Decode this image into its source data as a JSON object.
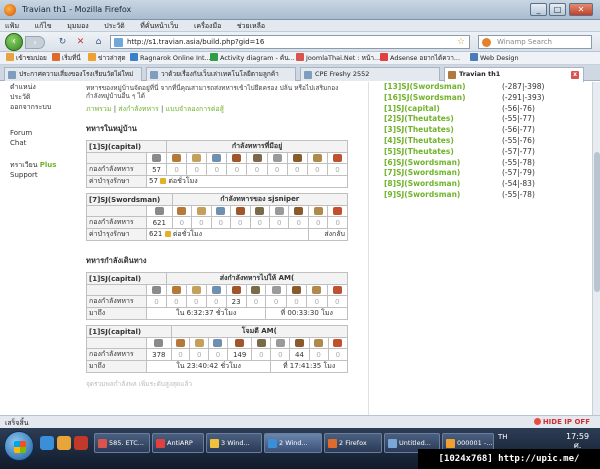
{
  "window": {
    "title": "Travian th1 - Mozilla Firefox",
    "min": "_",
    "max": "□",
    "close": "✕"
  },
  "menu": [
    "แฟ้ม",
    "แก้ไข",
    "มุมมอง",
    "ประวัติ",
    "ที่คั่นหน้าเว็บ",
    "เครื่องมือ",
    "ช่วยเหลือ"
  ],
  "nav": {
    "url": "http://s1.travian.asia/build.php?gid=16",
    "search_placeholder": "Winamp Search"
  },
  "bookmarks": [
    "เข้าชมบ่อย",
    "เริ่มที่นี่",
    "ข่าวล่าสุด",
    "Ragnarok Online Int...",
    "Activity diagram - ค้น...",
    "JoomlaThai.Net : หน้า...",
    "Adsense อยากได้ควา...",
    "Web Design"
  ],
  "tabs": [
    "ประกาศความเสี่ยงของโรงเรียนวัดไผ่ใหม่",
    "วาด้วยเรื่องกับเว็บเล่าเทคโนโลยีตามลูกค้า",
    "CPE Freshy 2552",
    "Travian th1"
  ],
  "leftmenu": {
    "items": [
      "ตำแหน่ง",
      "ประวัติ",
      "ออกจากระบบ"
    ],
    "forum": "Forum",
    "chat": "Chat",
    "plus_prefix": "ทราเวียน",
    "plus": "Plus",
    "support": "Support"
  },
  "main": {
    "intro": "ทหารของหมู่บ้านจัดอยู่ที่นี่ จากที่นี่คุณสามารถส่งทหารเข้าไปยึดครอง ปล้น หรือไปเสริมกองกำลังหมู่บ้านอื่น ๆ ได้",
    "links": [
      "ภาพรวม",
      "ส่งกำลังทหาร",
      "แบบจำลองการต่อสู้"
    ],
    "in_village": "ทหารในหมู่บ้าน",
    "on_move": "ทหารกำลังเดินทาง",
    "row_troops": "กองกำลังทหาร",
    "row_upkeep": "ค่าบำรุงรักษา",
    "row_arrival": "มาถึง",
    "per_hour": "ต่อชั่วโมง",
    "footnote": "จุดรวมพลกำลังพล เพิ่มระดับสูงสุดแล้ว",
    "tables": [
      {
        "village": "[1]SJ(capital)",
        "head": "กำลังทหารที่มีอยู่",
        "values": [
          "57",
          "0",
          "0",
          "0",
          "0",
          "0",
          "0",
          "0",
          "0",
          "0"
        ],
        "upkeep": "57",
        "extra": ""
      },
      {
        "village": "[7]SJ(Swordsman)",
        "head": "กำลังทหารของ sjsniper",
        "values": [
          "621",
          "0",
          "0",
          "0",
          "0",
          "0",
          "0",
          "0",
          "0",
          "0"
        ],
        "upkeep": "621",
        "extra": "ส่งกลับ"
      },
      {
        "village": "[1]SJ(capital)",
        "head": "ส่งกำลังทหารไปให้ AM(",
        "values": [
          "0",
          "0",
          "0",
          "0",
          "23",
          "0",
          "0",
          "0",
          "0",
          "0"
        ],
        "eta": "ใน 6:32:37 ชั่วโมง",
        "time": "ที่ 00:33:30 โมง"
      },
      {
        "village": "[1]SJ(capital)",
        "head": "โจมตี AM(",
        "values": [
          "378",
          "0",
          "0",
          "0",
          "149",
          "0",
          "0",
          "44",
          "0",
          "0"
        ],
        "eta": "ใน 23:40:42 ชั่วโมง",
        "time": "ที่ 17:41:35 โมง"
      }
    ]
  },
  "villages": [
    {
      "num": "[13]",
      "name": "SJ(Swordsman)",
      "coord": "(-287|-398)"
    },
    {
      "num": "[16]",
      "name": "SJ(Swordsman)",
      "coord": "(-291|-393)"
    },
    {
      "num": "[1]",
      "name": "SJ(capital)",
      "coord": "(-56|-76)"
    },
    {
      "num": "[2]",
      "name": "SJ(Theutates)",
      "coord": "(-55|-77)"
    },
    {
      "num": "[3]",
      "name": "SJ(Theutates)",
      "coord": "(-56|-77)"
    },
    {
      "num": "[4]",
      "name": "SJ(Theutates)",
      "coord": "(-55|-76)"
    },
    {
      "num": "[5]",
      "name": "SJ(Theutates)",
      "coord": "(-57|-77)"
    },
    {
      "num": "[6]",
      "name": "SJ(Swordsman)",
      "coord": "(-55|-78)"
    },
    {
      "num": "[7]",
      "name": "SJ(Swordsman)",
      "coord": "(-57|-79)"
    },
    {
      "num": "[8]",
      "name": "SJ(Swordsman)",
      "coord": "(-54|-83)"
    },
    {
      "num": "[9]",
      "name": "SJ(Swordsman)",
      "coord": "(-55|-78)"
    }
  ],
  "status": {
    "text": "เสร็จสิ้น",
    "hide_ip": "HIDE IP OFF"
  },
  "taskbar": {
    "items": [
      "585. ETC...",
      "AntiARP",
      "3 Wind...",
      "2 Wind...",
      "2 Firefox",
      "Untitled...",
      "000001 -..."
    ],
    "lang": "TH",
    "time": "17:59",
    "date": "ศ.",
    "watermark": "[1024x768] http://upic.me/"
  },
  "colors": {
    "accent": "#71b32b",
    "taskbar": "#1a2638"
  }
}
